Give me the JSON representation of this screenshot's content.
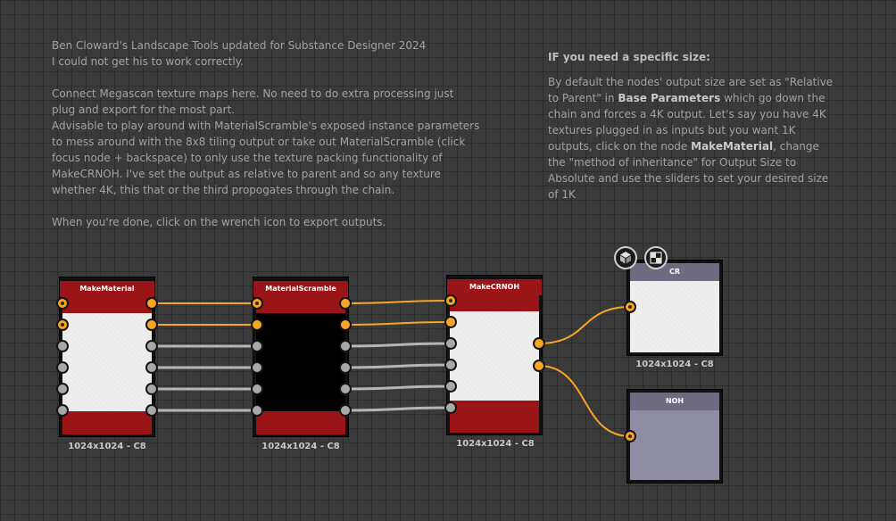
{
  "comment_left": {
    "lines": [
      "Ben Cloward's Landscape Tools updated for Substance Designer 2024",
      "I could not get his to work correctly.",
      "",
      "Connect Megascan texture maps here. No need to do extra processing  just",
      "plug and export for the most part.",
      "Advisable to play around with MaterialScramble's exposed instance parameters",
      "to mess around with the 8x8 tiling output or take out MaterialScramble (click",
      "focus node + backspace) to only use the texture packing functionality of",
      "MakeCRNOH. I've set the output as relative to parent and so any texture",
      "whether 4K, this that or the third propogates through the chain.",
      "",
      "When you're done, click on the wrench icon to export outputs."
    ]
  },
  "comment_right": {
    "heading": "IF you need a specific size:",
    "text_1": "By default the nodes' output size are set as \"Relative to Parent\" in ",
    "bold_1": "Base Parameters",
    "text_2": " which go down the chain and forces a 4K output. Let's say you have 4K textures plugged in as inputs but you want 1K outputs, click on the node ",
    "bold_2": "MakeMaterial",
    "text_3": ", change the \"method of inheritance\" for Output Size to Absolute and use the sliders to set your desired size of 1K"
  },
  "nodes": {
    "make_material": {
      "title": "MakeMaterial",
      "size": "1024x1024 - C8"
    },
    "material_scramble": {
      "title": "MaterialScramble",
      "size": "1024x1024 - C8"
    },
    "make_crnoh": {
      "title": "MakeCRNOH",
      "size": "1024x1024 - C8"
    },
    "output_cr": {
      "title": "CR",
      "size": "1024x1024 - C8"
    },
    "output_noh": {
      "title": "NOH"
    }
  },
  "colors": {
    "connection_orange": "#f7a623",
    "connection_gray": "#b5b5b5",
    "node_red": "#9b1418",
    "output_header": "#6e6a80",
    "output_noh_body": "#8f8ca5"
  },
  "icons": [
    "3d-view-icon",
    "2d-view-icon"
  ]
}
